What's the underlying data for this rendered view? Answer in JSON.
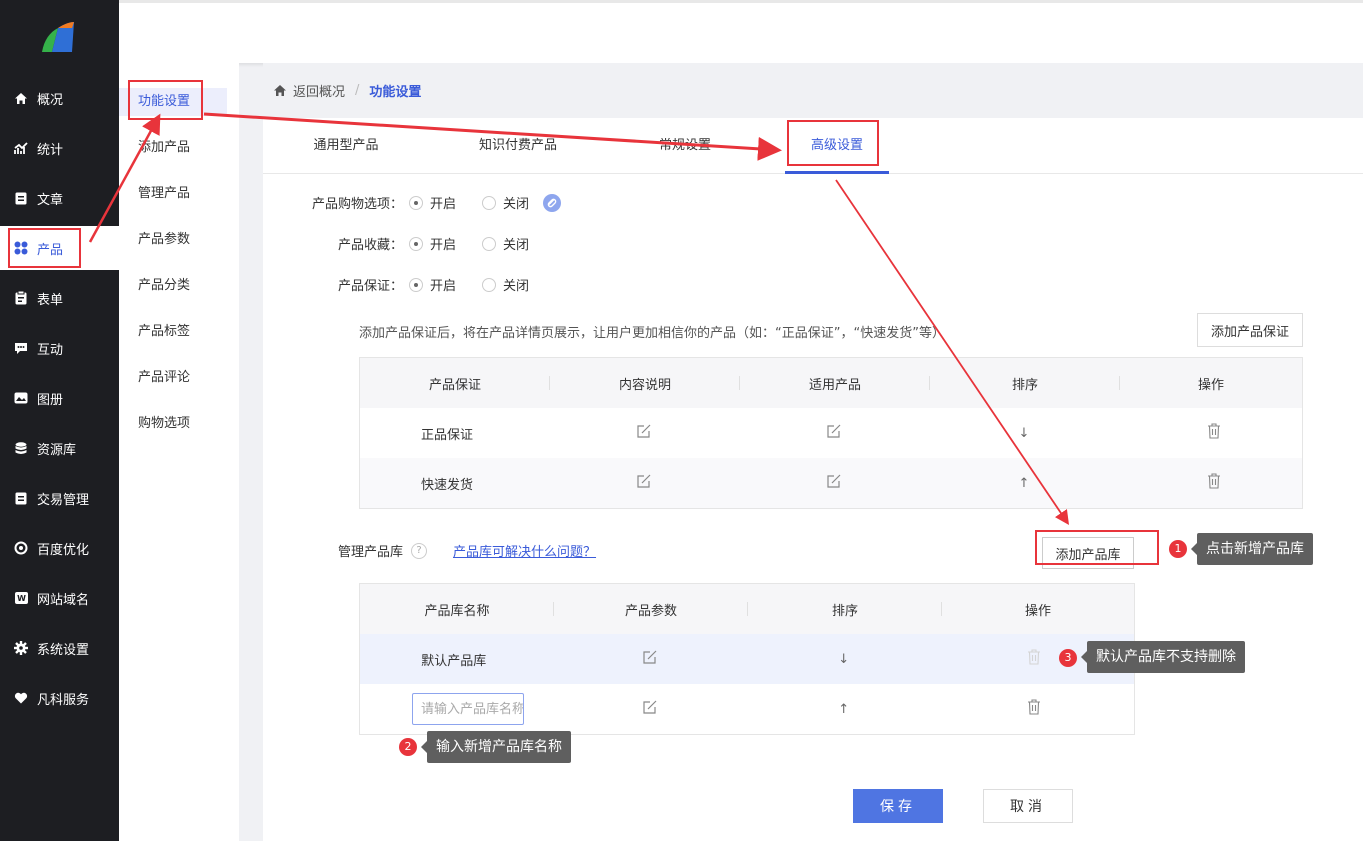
{
  "nav": [
    {
      "label": "概况",
      "icon": "home-icon"
    },
    {
      "label": "统计",
      "icon": "stats-icon"
    },
    {
      "label": "文章",
      "icon": "article-icon"
    },
    {
      "label": "产品",
      "icon": "product-icon"
    },
    {
      "label": "表单",
      "icon": "form-icon"
    },
    {
      "label": "互动",
      "icon": "chat-icon"
    },
    {
      "label": "图册",
      "icon": "album-icon"
    },
    {
      "label": "资源库",
      "icon": "database-icon"
    },
    {
      "label": "交易管理",
      "icon": "trade-icon"
    },
    {
      "label": "百度优化",
      "icon": "seo-icon"
    },
    {
      "label": "网站域名",
      "icon": "domain-icon"
    },
    {
      "label": "系统设置",
      "icon": "gear-icon"
    },
    {
      "label": "凡科服务",
      "icon": "heart-icon"
    }
  ],
  "subnav": [
    "功能设置",
    "添加产品",
    "管理产品",
    "产品参数",
    "产品分类",
    "产品标签",
    "产品评论",
    "购物选项"
  ],
  "breadcrumb": {
    "back": "返回概况",
    "sep": "/",
    "current": "功能设置"
  },
  "tabs": [
    "通用型产品",
    "知识付费产品",
    "常规设置",
    "高级设置"
  ],
  "options": [
    {
      "label": "产品购物选项：",
      "on": "开启",
      "off": "关闭"
    },
    {
      "label": "产品收藏：",
      "on": "开启",
      "off": "关闭"
    },
    {
      "label": "产品保证：",
      "on": "开启",
      "off": "关闭"
    }
  ],
  "guarantee": {
    "hint": "添加产品保证后，将在产品详情页展示，让用户更加相信你的产品（如：“正品保证”，“快速发货”等）",
    "add_button": "添加产品保证",
    "headers": [
      "产品保证",
      "内容说明",
      "适用产品",
      "排序",
      "操作"
    ],
    "rows": [
      {
        "name": "正品保证",
        "sort": "↓"
      },
      {
        "name": "快速发货",
        "sort": "↑"
      }
    ]
  },
  "library": {
    "label": "管理产品库",
    "help": "?",
    "link": "产品库可解决什么问题？",
    "add_button": "添加产品库",
    "headers": [
      "产品库名称",
      "产品参数",
      "排序",
      "操作"
    ],
    "rows": [
      {
        "name": "默认产品库",
        "sort": "↓"
      },
      {
        "placeholder": "请输入产品库名称",
        "sort": "↑"
      }
    ]
  },
  "tips": [
    {
      "num": "1",
      "text": "点击新增产品库"
    },
    {
      "num": "2",
      "text": "输入新增产品库名称"
    },
    {
      "num": "3",
      "text": "默认产品库不支持删除"
    }
  ],
  "footer": {
    "save": "保存",
    "cancel": "取消"
  },
  "colors": {
    "accent": "#3a5bd9",
    "annotation": "#e8343b",
    "sidebar": "#1d1e22"
  }
}
